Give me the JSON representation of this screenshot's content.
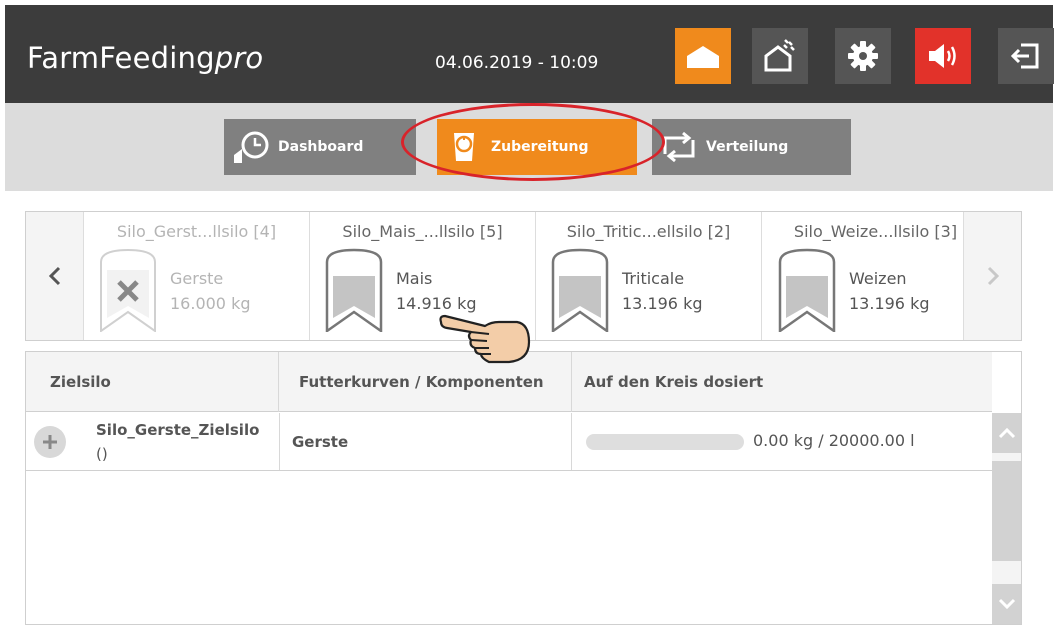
{
  "header": {
    "brand": "FarmFeeding",
    "brand_suffix": "pro",
    "datetime": "04.06.2019 - 10:09",
    "buttons": [
      "home-icon",
      "barn-icon",
      "gear-icon",
      "speaker-icon",
      "logout-icon"
    ]
  },
  "tabs": [
    {
      "label": "Dashboard",
      "icon": "history-icon",
      "active": false
    },
    {
      "label": "Zubereitung",
      "icon": "scale-icon",
      "active": true
    },
    {
      "label": "Verteilung",
      "icon": "repeat-icon",
      "active": false
    }
  ],
  "colors": {
    "accent": "#f08a1c",
    "alert": "#e2322a",
    "highlight": "#d8232a",
    "header_bg": "#3c3c3c"
  },
  "silos": [
    {
      "title": "Silo_Gerst...llsilo [4]",
      "name": "Gerste",
      "qty": "16.000 kg",
      "disabled": true
    },
    {
      "title": "Silo_Mais_...llsilo [5]",
      "name": "Mais",
      "qty": "14.916 kg",
      "disabled": false
    },
    {
      "title": "Silo_Tritic...ellsilo [2]",
      "name": "Triticale",
      "qty": "13.196 kg",
      "disabled": false
    },
    {
      "title": "Silo_Weize...llsilo [3]",
      "name": "Weizen",
      "qty": "13.196 kg",
      "disabled": false
    }
  ],
  "table": {
    "headers": [
      "Zielsilo",
      "Futterkurven / Komponenten",
      "Auf den Kreis dosiert"
    ],
    "rows": [
      {
        "name": "Silo_Gerste_Zielsilo",
        "sub": "()",
        "futter": "Gerste",
        "amount": "0.00 kg / 20000.00 l",
        "progress": 0
      }
    ]
  }
}
